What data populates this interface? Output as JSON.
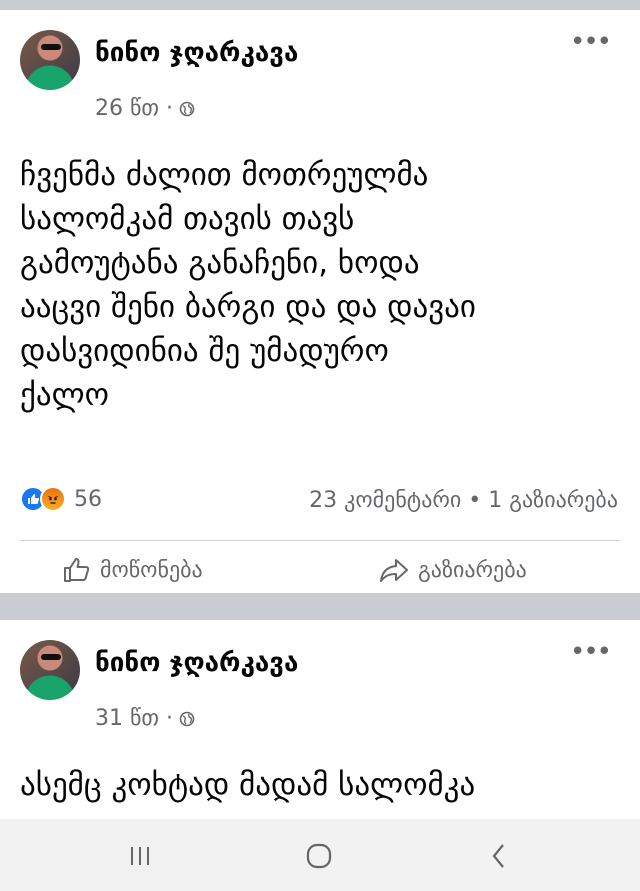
{
  "posts": [
    {
      "author": "ნინო ჯღარკავა",
      "time": "26 წთ ·",
      "privacy_icon": "globe-icon",
      "text": "ჩვენმა ძალით მოთრეულმა\nსალომკამ თავის თავს\nგამოუტანა განაჩენი, ხოდა\nააცვი შენი ბარგი და და  დავაი\nდასვიდინია შე უმადურო\nქალო",
      "reactions": {
        "types": [
          "like",
          "angry"
        ],
        "count": "56"
      },
      "stats": "23 კომენტარი • 1 გაზიარება",
      "actions": {
        "like": "მოწონება",
        "share": "გაზიარება"
      }
    },
    {
      "author": "ნინო ჯღარკავა",
      "time": "31 წთ ·",
      "privacy_icon": "globe-icon",
      "text": "ასემც კოხტად მადამ სალომკა"
    }
  ],
  "colors": {
    "primary_text": "#050505",
    "secondary_text": "#65676b",
    "like_blue": "#1877f2",
    "separator": "#c9ccd1"
  },
  "system_nav": {
    "icons": [
      "recent-apps-icon",
      "home-icon",
      "back-icon"
    ]
  }
}
